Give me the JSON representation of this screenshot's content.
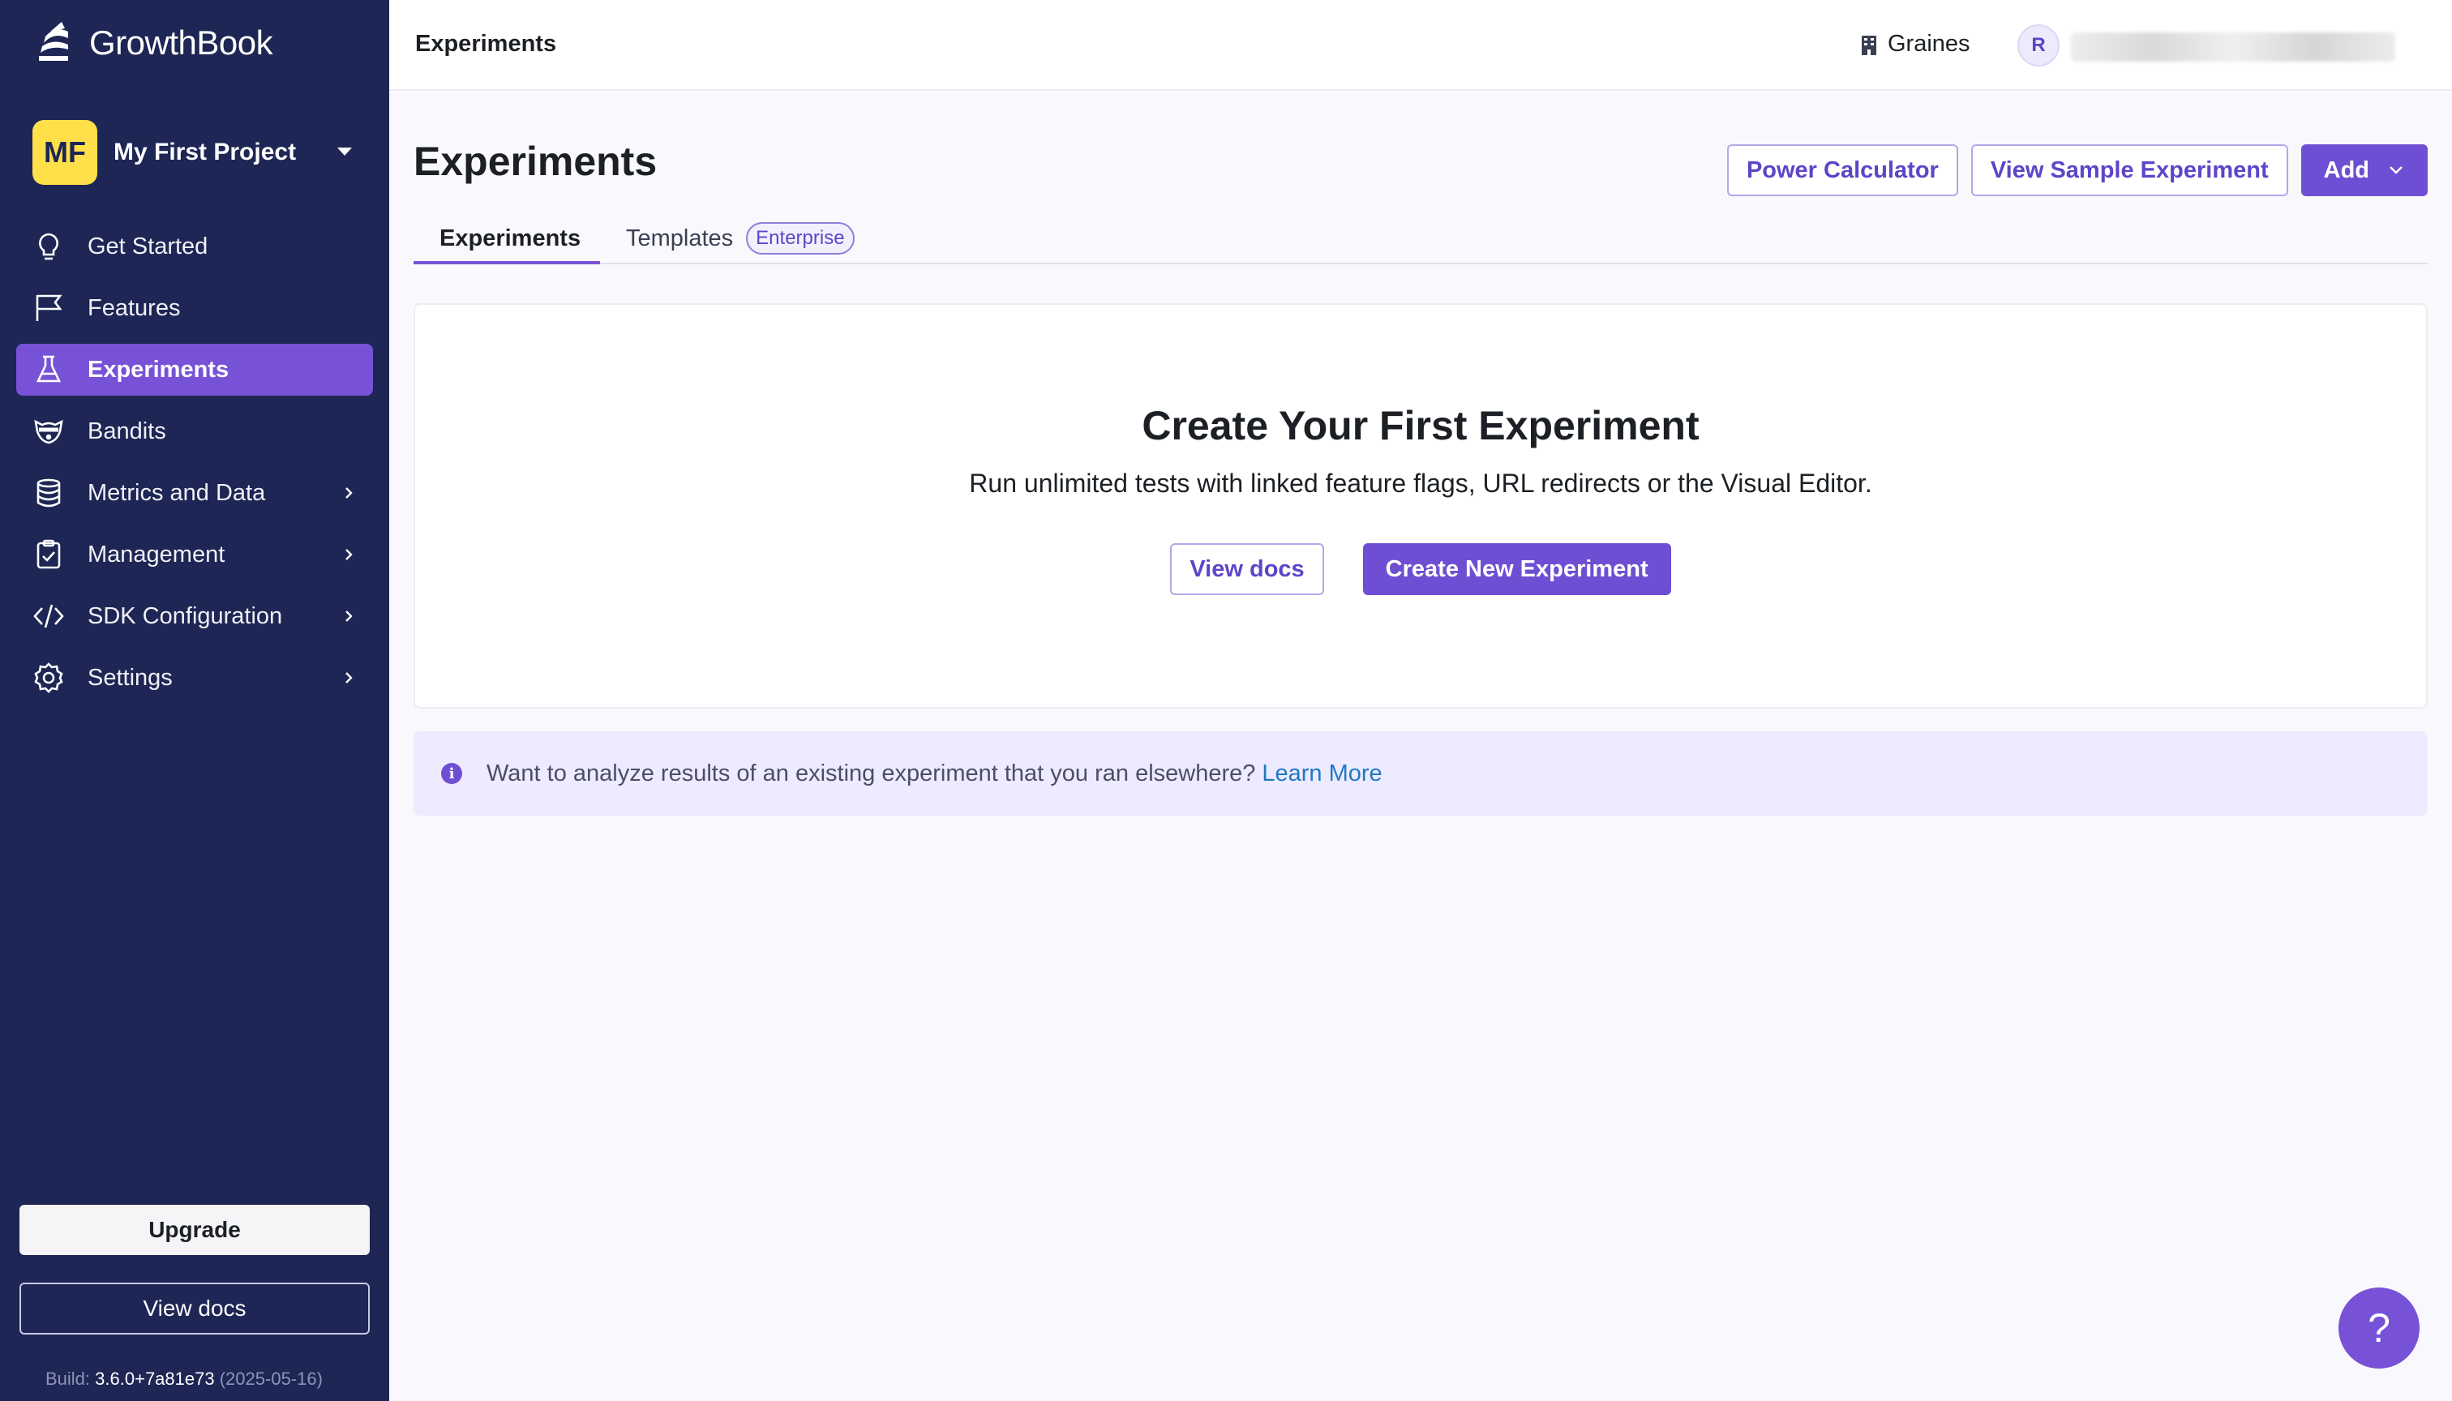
{
  "app": {
    "name": "GrowthBook"
  },
  "project": {
    "initials": "MF",
    "name": "My First Project"
  },
  "sidebar": {
    "items": [
      {
        "label": "Get Started",
        "icon": "lightbulb-icon"
      },
      {
        "label": "Features",
        "icon": "flag-icon"
      },
      {
        "label": "Experiments",
        "icon": "flask-icon",
        "active": true
      },
      {
        "label": "Bandits",
        "icon": "bandit-icon"
      },
      {
        "label": "Metrics and Data",
        "icon": "database-icon",
        "expandable": true
      },
      {
        "label": "Management",
        "icon": "clipboard-icon",
        "expandable": true
      },
      {
        "label": "SDK Configuration",
        "icon": "code-icon",
        "expandable": true
      },
      {
        "label": "Settings",
        "icon": "gear-icon",
        "expandable": true
      }
    ],
    "upgrade_label": "Upgrade",
    "view_docs_label": "View docs",
    "build_prefix": "Build:",
    "build_version": "3.6.0+7a81e73",
    "build_date": "(2025-05-16)"
  },
  "topbar": {
    "title": "Experiments",
    "org_name": "Graines",
    "user_initial": "R"
  },
  "main": {
    "title": "Experiments",
    "buttons": {
      "power_calculator": "Power Calculator",
      "view_sample": "View Sample Experiment",
      "add": "Add"
    },
    "tabs": [
      {
        "label": "Experiments",
        "active": true
      },
      {
        "label": "Templates",
        "badge": "Enterprise"
      }
    ],
    "empty_state": {
      "title": "Create Your First Experiment",
      "subtitle": "Run unlimited tests with linked feature flags, URL redirects or the Visual Editor.",
      "view_docs": "View docs",
      "create": "Create New Experiment"
    },
    "callout": {
      "text": "Want to analyze results of an existing experiment that you ran elsewhere?",
      "link": "Learn More"
    }
  },
  "help": {
    "label": "?"
  },
  "colors": {
    "sidebar_bg": "#1d2654",
    "accent": "#7752d6",
    "project_avatar": "#ffe04b",
    "link": "#1f7ac4"
  }
}
